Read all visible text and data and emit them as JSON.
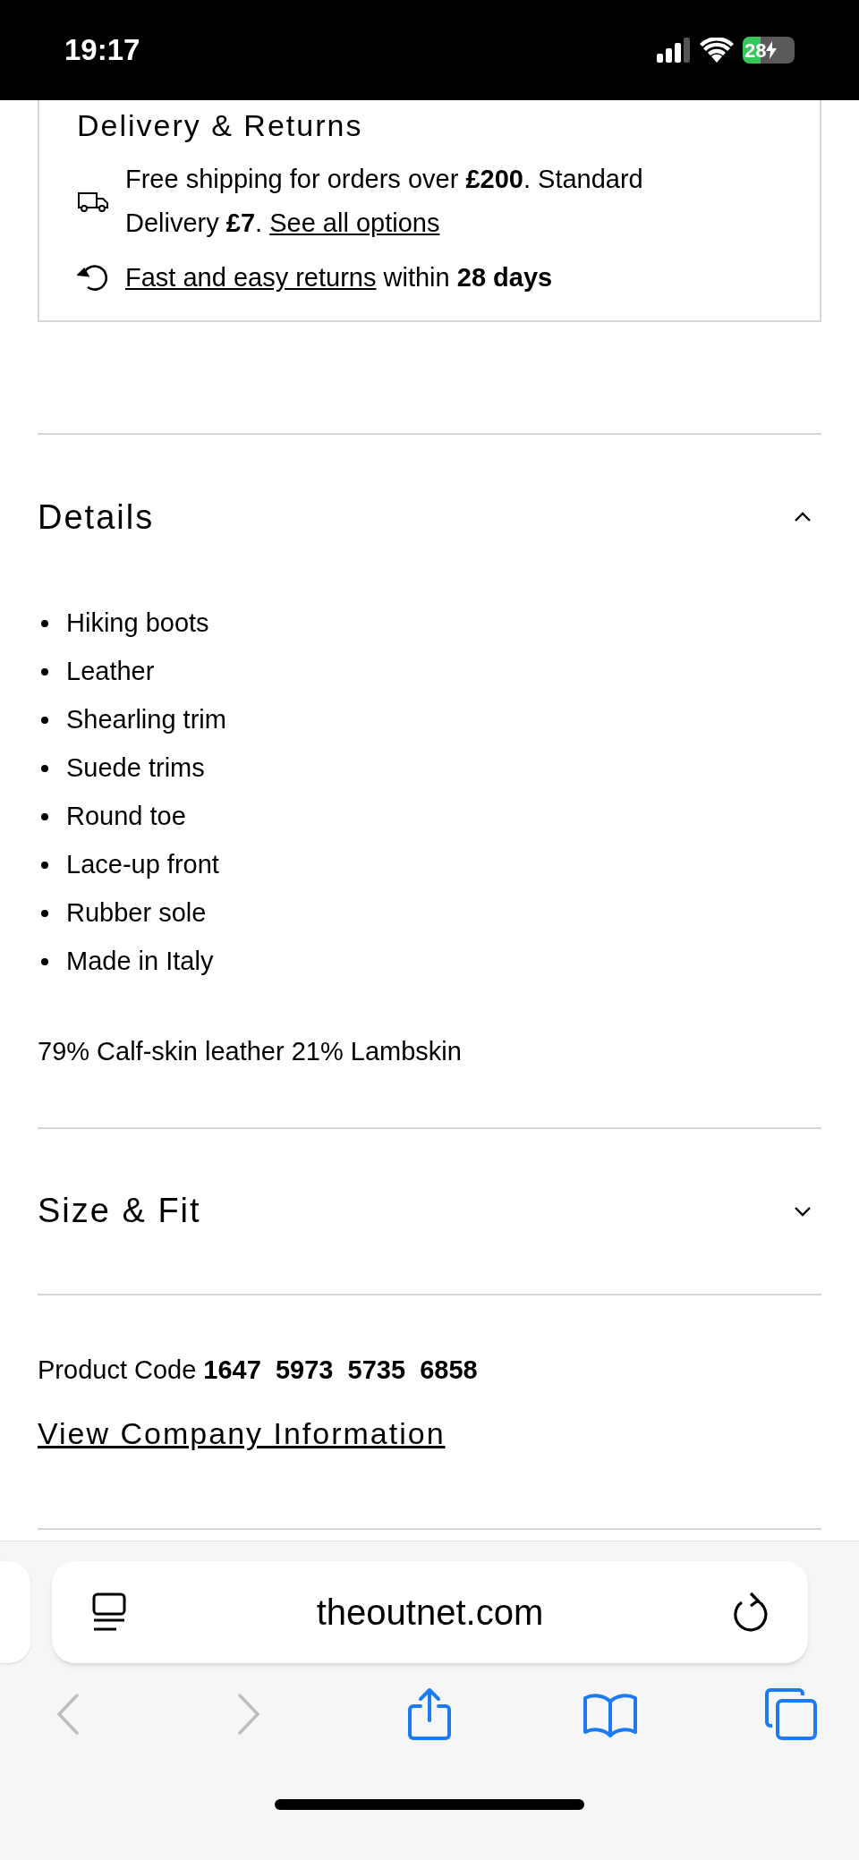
{
  "status_bar": {
    "time": "19:17",
    "battery": "28"
  },
  "delivery": {
    "title": "Delivery & Returns",
    "shipping_text": "Free shipping for orders over **£200**. Standard Delivery **£7**.",
    "shipping_link": "See all options",
    "returns_link": "Fast and easy returns",
    "returns_text": "within **28 days**"
  },
  "sections": [
    {
      "title": "Details",
      "expanded": true,
      "bullets": [
        "Hiking boots",
        "Leather",
        "Shearling trim",
        "Suede trims",
        "Round toe",
        "Lace-up front",
        "Rubber sole",
        "Made in Italy"
      ],
      "composition": "79% Calf-skin leather 21% Lambskin"
    },
    {
      "title": "Size & Fit",
      "expanded": false
    }
  ],
  "product_code": {
    "label": "Product Code",
    "value": "1647  5973  5735  6858"
  },
  "company_link": "View Company Information",
  "browser": {
    "url": "theoutnet.com",
    "toolbar": [
      {
        "kind": "back",
        "disabled": true
      },
      {
        "kind": "forward",
        "disabled": true
      },
      {
        "kind": "share",
        "disabled": false
      },
      {
        "kind": "bookmarks",
        "disabled": false
      },
      {
        "kind": "tabs",
        "disabled": false
      }
    ]
  }
}
